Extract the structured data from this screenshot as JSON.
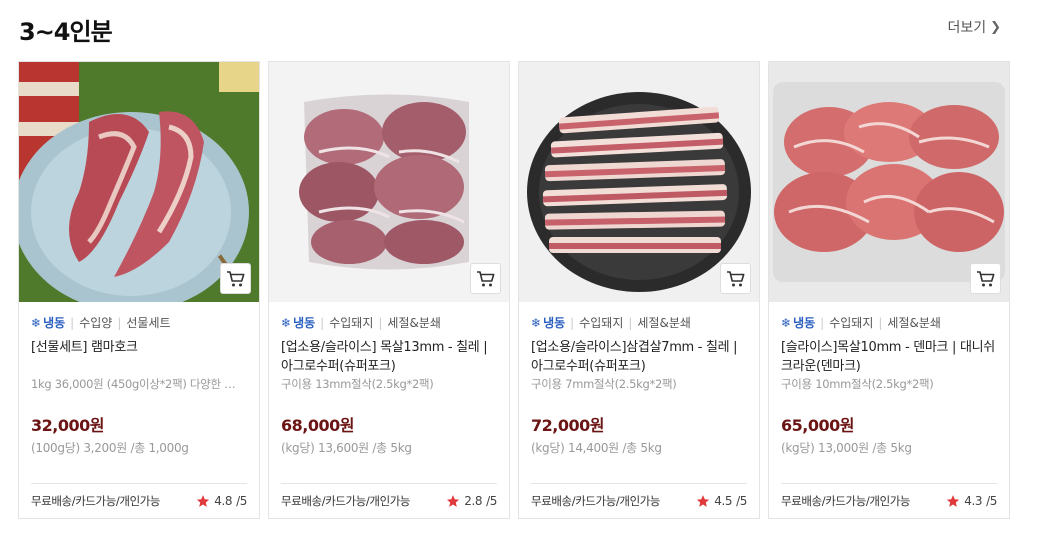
{
  "section": {
    "title": "3~4인분",
    "more_label": "더보기",
    "more_icon": "chevron-right-icon"
  },
  "colors": {
    "price": "#6b1414",
    "frozen": "#2a5fc0",
    "star": "#e0393c"
  },
  "products": [
    {
      "tags": [
        "냉동",
        "수입양",
        "선물세트"
      ],
      "name": "[선물세트] 램마호크",
      "desc": "1kg 36,000원 (450g이상*2팩) 다양한 …",
      "price": "32,000원",
      "unit": "(100g당) 3,200원 /총 1,000g",
      "shipping": "무료배송/카드가능/개인가능",
      "rating": "4.8",
      "rating_max": "/5"
    },
    {
      "tags": [
        "냉동",
        "수입돼지",
        "세절&분쇄"
      ],
      "name": "[업소용/슬라이스] 목살13mm - 칠레 | 아그로수퍼(슈퍼포크)",
      "desc": "구이용 13mm절삭(2.5kg*2팩)",
      "price": "68,000원",
      "unit": "(kg당) 13,600원 /총 5kg",
      "shipping": "무료배송/카드가능/개인가능",
      "rating": "2.8",
      "rating_max": "/5"
    },
    {
      "tags": [
        "냉동",
        "수입돼지",
        "세절&분쇄"
      ],
      "name": "[업소용/슬라이스]삼겹살7mm - 칠레 | 아그로수퍼(슈퍼포크)",
      "desc": "구이용 7mm절삭(2.5kg*2팩)",
      "price": "72,000원",
      "unit": "(kg당) 14,400원 /총 5kg",
      "shipping": "무료배송/카드가능/개인가능",
      "rating": "4.5",
      "rating_max": "/5"
    },
    {
      "tags": [
        "냉동",
        "수입돼지",
        "세절&분쇄"
      ],
      "name": "[슬라이스]목살10mm - 덴마크 | 대니쉬크라운(덴마크)",
      "desc": "구이용 10mm절삭(2.5kg*2팩)",
      "price": "65,000원",
      "unit": "(kg당) 13,000원 /총 5kg",
      "shipping": "무료배송/카드가능/개인가능",
      "rating": "4.3",
      "rating_max": "/5"
    }
  ]
}
